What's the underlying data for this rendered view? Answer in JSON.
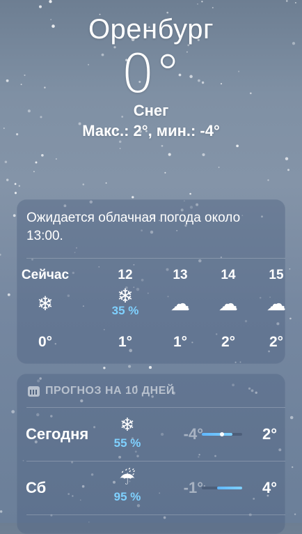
{
  "header": {
    "city": "Оренбург",
    "temperature": "0°",
    "condition": "Снег",
    "high_low": "Макс.: 2°, мин.: -4°"
  },
  "hourly": {
    "summary": "Ожидается облачная погода около 13:00.",
    "items": [
      {
        "label": "Сейчас",
        "icon": "snowflake-icon",
        "glyph": "❄",
        "precip": "",
        "temp": "0°"
      },
      {
        "label": "12",
        "icon": "snowflake-icon",
        "glyph": "❄",
        "precip": "35 %",
        "temp": "1°"
      },
      {
        "label": "13",
        "icon": "cloud-icon",
        "glyph": "☁",
        "precip": "",
        "temp": "1°"
      },
      {
        "label": "14",
        "icon": "cloud-icon",
        "glyph": "☁",
        "precip": "",
        "temp": "2°"
      },
      {
        "label": "15",
        "icon": "cloud-icon",
        "glyph": "☁",
        "precip": "",
        "temp": "2°"
      }
    ]
  },
  "daily": {
    "title": "ПРОГНОЗ НА 10 ДНЕЙ",
    "range": {
      "min": -4,
      "max": 4
    },
    "days": [
      {
        "name": "Сегодня",
        "icon": "snowflake-icon",
        "glyph": "❄",
        "precip": "55 %",
        "low": "-4°",
        "high": "2°",
        "low_value": -4,
        "high_value": 2,
        "current_value": 0
      },
      {
        "name": "Сб",
        "icon": "cloud-rain-icon",
        "glyph": "☔",
        "precip": "95 %",
        "low": "-1°",
        "high": "4°",
        "low_value": -1,
        "high_value": 4
      }
    ]
  },
  "colors": {
    "precip": "#7fd1ff",
    "bar_start": "#5fb7ff",
    "bar_end": "#7fd1ff"
  }
}
